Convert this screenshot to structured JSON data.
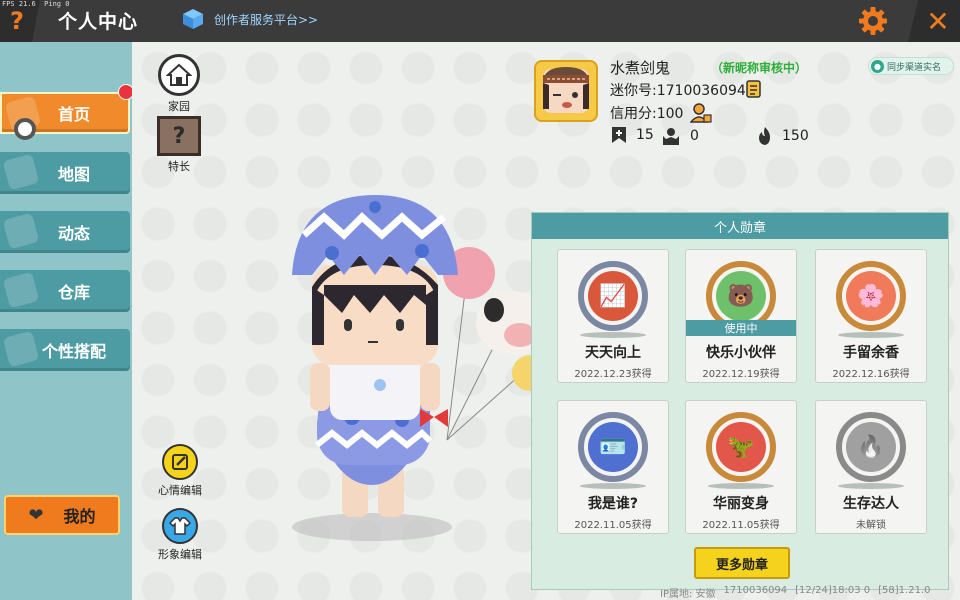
{
  "debug": {
    "fps": "FPS 21.6",
    "ping": "Ping 0"
  },
  "header": {
    "help_icon": "question-mark-icon",
    "title": "个人中心",
    "creator_link": "创作者服务平台>>",
    "settings_icon": "gear-icon",
    "close_icon": "close-icon",
    "accent_color": "#f07a1e"
  },
  "nav": {
    "items": [
      {
        "label": "首页",
        "icon": "home-icon",
        "active": true
      },
      {
        "label": "地图",
        "icon": "map-icon",
        "active": false
      },
      {
        "label": "动态",
        "icon": "bell-icon",
        "active": false
      },
      {
        "label": "仓库",
        "icon": "warehouse-icon",
        "active": false
      },
      {
        "label": "个性搭配",
        "icon": "outfit-icon",
        "active": false
      }
    ],
    "mine_label": "我的"
  },
  "side_buttons": {
    "home": "家园",
    "skill": "特长",
    "mood_edit": "心情编辑",
    "image_edit": "形象编辑"
  },
  "profile": {
    "name": "水煮剑鬼",
    "name_status": "（新昵称审核中）",
    "mini_id": "迷你号:1710036094",
    "credit": "信用分:100",
    "stats": {
      "likes": "15",
      "followers": "0",
      "heat": "150"
    },
    "sync_label": "同步渠道实名"
  },
  "badges": {
    "title": "个人勋章",
    "in_use_label": "使用中",
    "more_label": "更多勋章",
    "items": [
      {
        "name": "天天向上",
        "date": "2022.12.23获得",
        "icon": "chart-medal-icon"
      },
      {
        "name": "快乐小伙伴",
        "date": "2022.12.19获得",
        "icon": "friends-medal-icon",
        "in_use": true
      },
      {
        "name": "手留余香",
        "date": "2022.12.16获得",
        "icon": "flower-medal-icon"
      },
      {
        "name": "我是谁?",
        "date": "2022.11.05获得",
        "icon": "card-medal-icon"
      },
      {
        "name": "华丽变身",
        "date": "2022.11.05获得",
        "icon": "transform-medal-icon"
      },
      {
        "name": "生存达人",
        "date": "未解锁",
        "icon": "fire-medal-icon",
        "locked": true
      }
    ]
  },
  "footer": {
    "ip": "IP属地: 安徽",
    "uid": "1710036094",
    "time": "[12/24]18:03 0",
    "version": "[58]1.21.0"
  }
}
